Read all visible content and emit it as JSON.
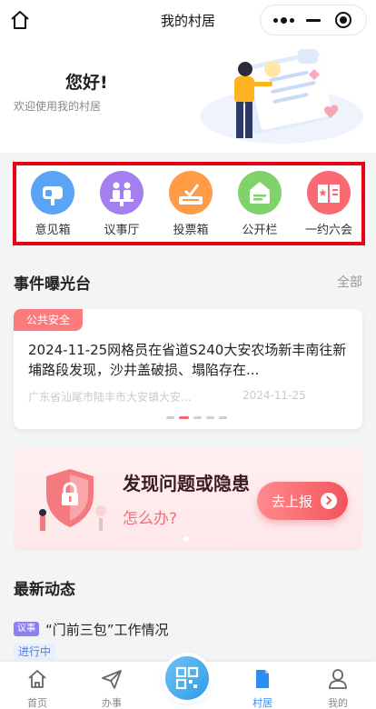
{
  "nav": {
    "title": "我的村居"
  },
  "header": {
    "greeting": "您好!",
    "welcome": "欢迎使用我的村居"
  },
  "quick_actions": [
    {
      "label": "意见箱",
      "icon": "mailbox-icon",
      "color": "#5aa4f6"
    },
    {
      "label": "议事厅",
      "icon": "meeting-icon",
      "color": "#a37ff0"
    },
    {
      "label": "投票箱",
      "icon": "ballot-box-icon",
      "color": "#ff9a45"
    },
    {
      "label": "公开栏",
      "icon": "bulletin-board-icon",
      "color": "#7fd36a"
    },
    {
      "label": "一约六会",
      "icon": "book-icon",
      "color": "#f96a72"
    }
  ],
  "events": {
    "title": "事件曝光台",
    "more": "全部",
    "tag": "公共安全",
    "text": "2024-11-25网格员在省道S240大安农场新丰南往新埔路段发现，沙井盖破损、塌陷存在...",
    "location": "广东省汕尾市陆丰市大安镇大安...",
    "date": "2024-11-25"
  },
  "banner": {
    "title": "发现问题或隐患",
    "subtitle": "怎么办?",
    "button": "去上报"
  },
  "news": {
    "title": "最新动态",
    "item_label": "议事",
    "item_title": "“门前三包”工作情况",
    "item_status": "进行中"
  },
  "tabbar": [
    {
      "label": "首页",
      "icon": "home-icon"
    },
    {
      "label": "办事",
      "icon": "send-icon"
    },
    {
      "label": "村居",
      "icon": "bookmark-icon",
      "active": true
    },
    {
      "label": "我的",
      "icon": "user-icon"
    }
  ],
  "colors": {
    "accent": "#2a8ff0",
    "danger": "#f2555b",
    "highlight_border": "#e60012"
  }
}
